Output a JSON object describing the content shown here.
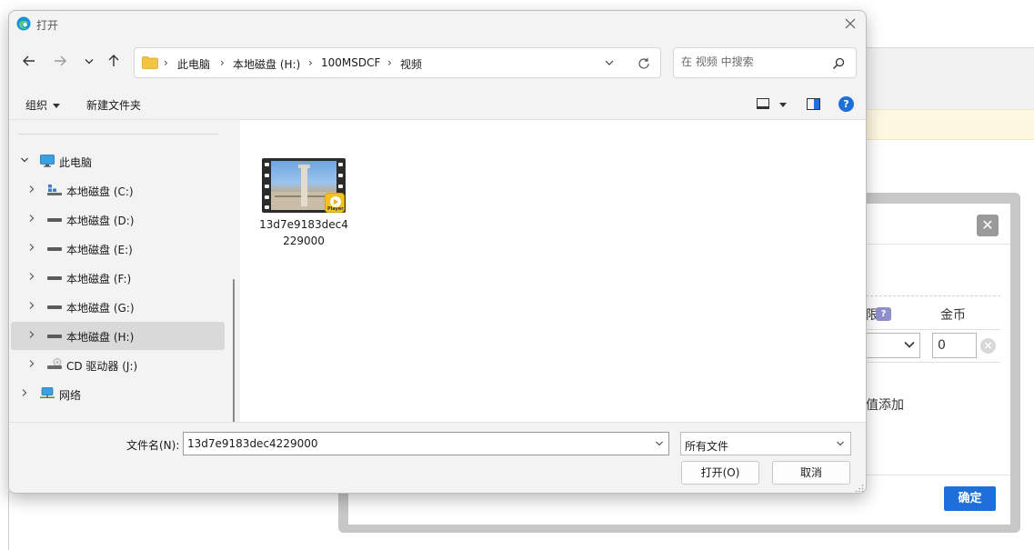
{
  "background": {
    "column_suffix": "限",
    "column_coin": "金币",
    "coin_value": "0",
    "add_text": "值添加",
    "close_glyph": "✕",
    "confirm_label": "确定"
  },
  "dialog": {
    "title": "打开",
    "address": {
      "crumbs": [
        "此电脑",
        "本地磁盘 (H:)",
        "100MSDCF",
        "视频"
      ],
      "separator": "›"
    },
    "search": {
      "placeholder": "在 视频 中搜索"
    },
    "commands": {
      "organize": "组织",
      "new_folder": "新建文件夹",
      "help": "?"
    },
    "tree": [
      {
        "label": "此电脑",
        "icon": "monitor-icon",
        "expanded": true
      },
      {
        "label": "本地磁盘 (C:)",
        "icon": "windows-drive-icon"
      },
      {
        "label": "本地磁盘 (D:)",
        "icon": "drive-icon"
      },
      {
        "label": "本地磁盘 (E:)",
        "icon": "drive-icon"
      },
      {
        "label": "本地磁盘 (F:)",
        "icon": "drive-icon"
      },
      {
        "label": "本地磁盘 (G:)",
        "icon": "drive-icon"
      },
      {
        "label": "本地磁盘 (H:)",
        "icon": "drive-icon",
        "selected": true
      },
      {
        "label": "CD 驱动器 (J:)",
        "icon": "cd-drive-icon"
      },
      {
        "label": "网络",
        "icon": "network-icon"
      }
    ],
    "files": [
      {
        "name": "13d7e9183dec4229000",
        "badge": "Player"
      }
    ],
    "filename_label": "文件名(N):",
    "filename_value": "13d7e9183dec4229000",
    "filetype_value": "所有文件",
    "open_label": "打开(O)",
    "cancel_label": "取消"
  },
  "colors": {
    "accent": "#1e6fd9",
    "selection": "#d9d9d9",
    "confirm": "#1e6fd9",
    "badge": "#f4c21d"
  }
}
